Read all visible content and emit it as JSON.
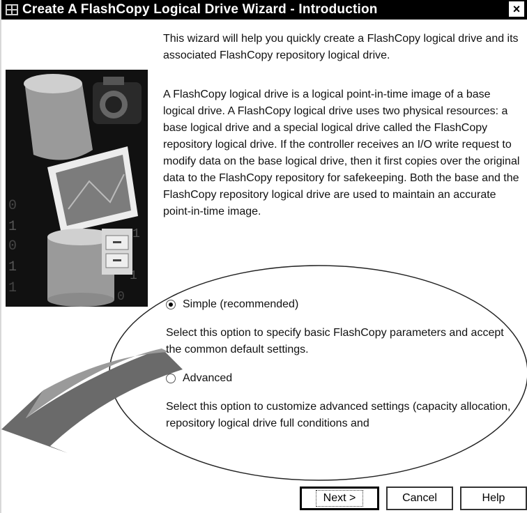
{
  "window": {
    "title": "Create A FlashCopy Logical Drive Wizard - Introduction",
    "close_glyph": "×"
  },
  "intro": {
    "para1": "This wizard will help you quickly create a FlashCopy logical drive and its associated FlashCopy repository logical drive.",
    "para2": "A FlashCopy logical drive is a logical point-in-time image of a base logical drive. A FlashCopy logical drive uses two physical resources: a base logical drive and a special logical drive called the FlashCopy repository logical drive. If the controller receives an I/O write request to modify data on the base logical drive, then it first copies over the original data to the FlashCopy repository for safekeeping. Both the base and the FlashCopy repository logical drive are used to maintain an accurate point-in-time image."
  },
  "options": {
    "simple": {
      "label": "Simple (recommended)",
      "selected": true,
      "description": "Select this option to specify basic FlashCopy parameters and accept the common default settings."
    },
    "advanced": {
      "label": "Advanced",
      "selected": false,
      "description": "Select this option to customize advanced settings (capacity allocation, repository logical drive full conditions and"
    }
  },
  "buttons": {
    "next": "Next >",
    "cancel": "Cancel",
    "help": "Help"
  },
  "icons": {
    "window": "window-app-icon",
    "close": "close-icon",
    "illustration": "flashcopy-illustration",
    "arrow": "curved-arrow-graphic"
  },
  "colors": {
    "titlebar": "#000000",
    "background": "#ffffff"
  }
}
